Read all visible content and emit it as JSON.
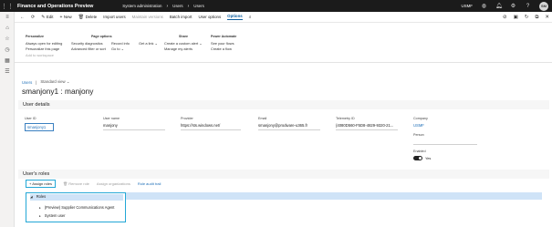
{
  "topbar": {
    "app_title": "Finance and Operations Preview",
    "breadcrumb": [
      "System administration",
      "Users",
      "Users"
    ],
    "company": "USMF",
    "avatar": "SM"
  },
  "actionbar": {
    "edit": "Edit",
    "new": "New",
    "delete": "Delete",
    "import_users": "Import users",
    "maintain_versions": "Maintain versions",
    "batch_import": "Batch import",
    "user_options": "User options",
    "options_tab": "Options"
  },
  "ribbon": {
    "personalize": {
      "title": "Personalize",
      "items": [
        "Always open for editing",
        "Personalize this page",
        "Add to workspace"
      ]
    },
    "page_options": {
      "title": "Page options",
      "col1": [
        "Security diagnostics",
        "Advanced filter or sort"
      ],
      "col2": [
        "Record info",
        "Go to"
      ],
      "col3": [
        "Get a link"
      ]
    },
    "share": {
      "title": "Share",
      "items": [
        "Create a custom alert",
        "Manage my alerts"
      ]
    },
    "power_automate": {
      "title": "Power Automate",
      "items": [
        "See your flows",
        "Create a flow"
      ]
    }
  },
  "page": {
    "crumb_link": "Users",
    "crumb_view": "Standard view",
    "title": "smanjony1 : manjony"
  },
  "user_details": {
    "header": "User details",
    "user_id_label": "User ID",
    "user_id": "smanjony1",
    "user_name_label": "User name",
    "user_name": "manjony",
    "provider_label": "Provider",
    "provider": "https://sts.windows.net/",
    "email_label": "Email",
    "email": "smanjony@prodware-u365.fr",
    "telemetry_label": "Telemetry ID",
    "telemetry": "{4080D560-F5D8-4829-9320-21...",
    "company_label": "Company",
    "company": "USMF",
    "person_label": "Person",
    "person": "",
    "enabled_label": "Enabled",
    "enabled": "Yes"
  },
  "roles": {
    "header": "User's roles",
    "assign_roles": "Assign roles",
    "remove_role": "Remove role",
    "assign_organizations": "Assign organizations",
    "role_audit_trail": "Role audit trail",
    "tree": {
      "root": "Roles",
      "children": [
        "(Preview) Supplier Communications Agent",
        "System user"
      ]
    }
  }
}
